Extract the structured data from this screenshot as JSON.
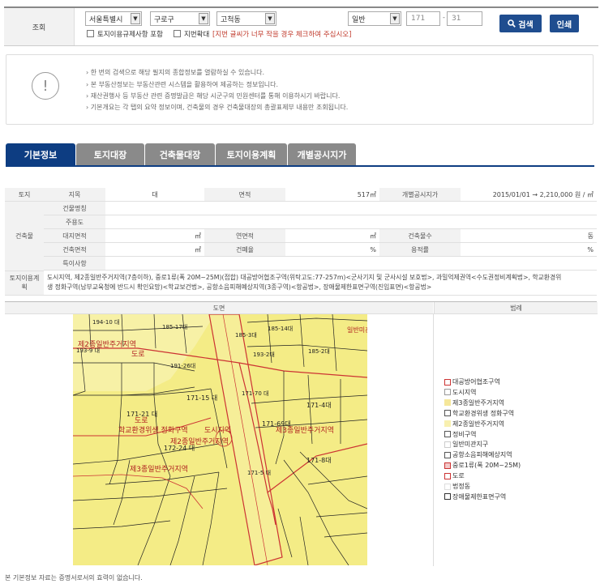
{
  "search": {
    "label": "조회",
    "sido": "서울특별시",
    "sigungu": "구로구",
    "dong": "고척동",
    "land_type": "일반",
    "bonbun": "171",
    "dash": "-",
    "bubun": "31",
    "search_btn": "검색",
    "print_btn": "인쇄",
    "opt1": "토지이용규제사항 포함",
    "opt2": "지번확대",
    "opt2_note": "[지번 글씨가 너무 작을 경우 체크하여 주십시오]"
  },
  "info": {
    "icon": "exclamation-icon",
    "lines": [
      "한 번의 검색으로 해당 필지의 종합정보를 열람하실 수 있습니다.",
      "본 부동산정보는 부동산관련 시스템을 활용하여 제공하는 정보입니다.",
      "재산권행사 등 부동산 관련 증명발급은 해당 시군구의 민원센터를 통해 이용하시기 바랍니다.",
      "기본개요는 각 탭의 요약 정보이며, 건축물의 경우 건축물대장의 총괄표제부 내용만 조회됩니다."
    ]
  },
  "tabs": [
    {
      "label": "기본정보",
      "active": true
    },
    {
      "label": "토지대장",
      "active": false
    },
    {
      "label": "건축물대장",
      "active": false
    },
    {
      "label": "토지이용계획",
      "active": false
    },
    {
      "label": "개별공시지가",
      "active": false
    }
  ],
  "table": {
    "land_h": "토지",
    "jimok_h": "지목",
    "jimok_v": "대",
    "area_h": "면적",
    "area_v": "517㎡",
    "price_h": "개별공시지가",
    "price_v": "2015/01/01 → 2,210,000 원 / ㎡",
    "bldg_h": "건축물",
    "bname_h": "건물명칭",
    "use_h": "주용도",
    "site_h": "대지면적",
    "site_v": "㎡",
    "floor_h": "연면적",
    "floor_v": "㎡",
    "count_h": "건축물수",
    "count_v": "동",
    "barea_h": "건축면적",
    "barea_v": "㎡",
    "bcr_h": "건폐율",
    "bcr_v": "%",
    "far_h": "용적률",
    "far_v": "%",
    "etc_h": "특이사항",
    "plan_h": "토지이용계획",
    "plan_v1": "도시지역, 제2종일반주거지역(7층이하), 중로1류(폭 20M~25M)(접합) 대공방어협조구역(위탁고도:77-257m)<군사기지 및 군사시설 보호법>, 과밀억제권역<수도권정비계획법>, 학교환경위",
    "plan_v2": "생 정화구역(남부교육청에 반드시 확인요망)<학교보건법>, 공항소음피해예상지역(3종구역)<항공법>, 장애물제한표면구역(진입표면)<항공법>"
  },
  "map": {
    "title": "도면",
    "legend_title": "범례",
    "labels": [
      "제2종일반주거지역",
      "도로",
      "193-9 대",
      "185-17대",
      "193-2대",
      "191-26대",
      "185-14대",
      "171-15 대",
      "171-21 대",
      "171-4대",
      "171-69대",
      "172-24 대",
      "171-8대",
      "학교환경위생 정화구역",
      "제2종일반주거지역",
      "제3종일반주거지역",
      "도시지역",
      "일반미관",
      "194-10 대",
      "185-3대",
      "185-2대",
      "171-70 대",
      "171-5 대"
    ]
  },
  "legend": [
    {
      "label": "대공방어협조구역",
      "color": "#cc3333",
      "fill": "#fff"
    },
    {
      "label": "도시지역",
      "color": "#999999",
      "fill": "#fff"
    },
    {
      "label": "제3종일반주거지역",
      "color": "#f5e79a",
      "fill": "#f5e79a"
    },
    {
      "label": "학교환경위생 정화구역",
      "color": "#555555",
      "fill": "#fff"
    },
    {
      "label": "제2종일반주거지역",
      "color": "#f8f0b0",
      "fill": "#f8f0b0"
    },
    {
      "label": "정비구역",
      "color": "#555555",
      "fill": "#fff"
    },
    {
      "label": "일반미관지구",
      "color": "#cccccc",
      "fill": "#fff"
    },
    {
      "label": "공항소음피해예상지역",
      "color": "#555555",
      "fill": "#fff"
    },
    {
      "label": "중로1류(폭 20M~25M)",
      "color": "#cc3333",
      "fill": "#f3c9c9"
    },
    {
      "label": "도로",
      "color": "#cc3333",
      "fill": "#fff"
    },
    {
      "label": "법정동",
      "color": "#dddddd",
      "fill": "#fff"
    },
    {
      "label": "장애물제한표면구역",
      "color": "#333333",
      "fill": "#fff"
    }
  ],
  "footer": "본 기본정보 자료는 증명서로서의 효력이 없습니다."
}
